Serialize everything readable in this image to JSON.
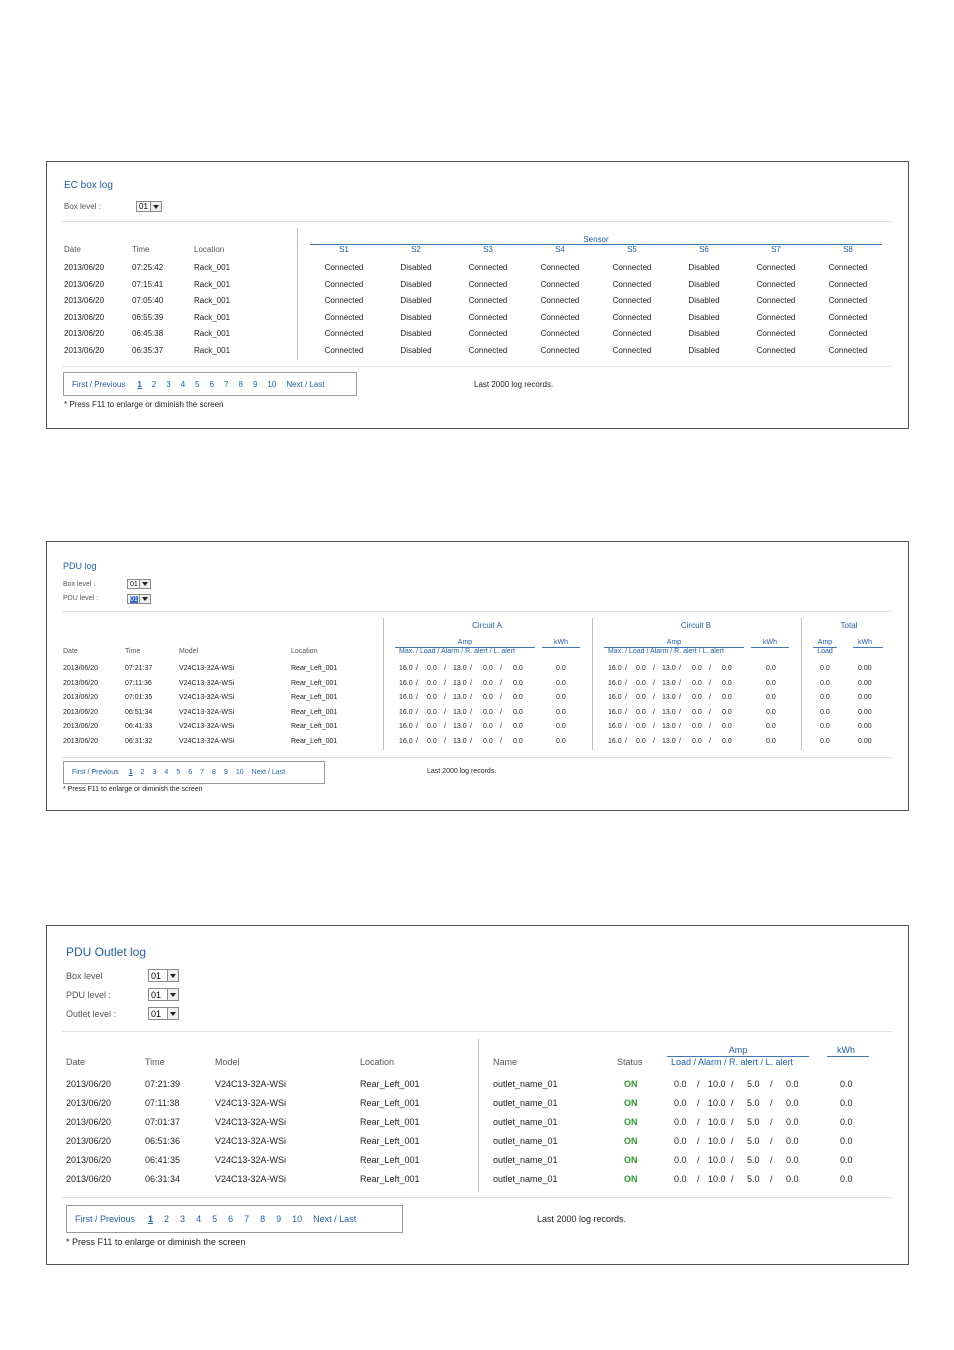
{
  "ec": {
    "title": "EC  box  log",
    "box_level_label": "Box level :",
    "box_level_value": "01",
    "headers": {
      "date": "Date",
      "time": "Time",
      "location": "Location"
    },
    "sensor_group": "Sensor",
    "sensors": [
      "S1",
      "S2",
      "S3",
      "S4",
      "S5",
      "S6",
      "S7",
      "S8"
    ],
    "rows": [
      {
        "date": "2013/06/20",
        "time": "07:25:42",
        "location": "Rack_001",
        "s": [
          "Connected",
          "Disabled",
          "Connected",
          "Connected",
          "Connected",
          "Disabled",
          "Connected",
          "Connected"
        ]
      },
      {
        "date": "2013/06/20",
        "time": "07:15:41",
        "location": "Rack_001",
        "s": [
          "Connected",
          "Disabled",
          "Connected",
          "Connected",
          "Connected",
          "Disabled",
          "Connected",
          "Connected"
        ]
      },
      {
        "date": "2013/06/20",
        "time": "07:05:40",
        "location": "Rack_001",
        "s": [
          "Connected",
          "Disabled",
          "Connected",
          "Connected",
          "Connected",
          "Disabled",
          "Connected",
          "Connected"
        ]
      },
      {
        "date": "2013/06/20",
        "time": "06:55:39",
        "location": "Rack_001",
        "s": [
          "Connected",
          "Disabled",
          "Connected",
          "Connected",
          "Connected",
          "Disabled",
          "Connected",
          "Connected"
        ]
      },
      {
        "date": "2013/06/20",
        "time": "06:45:38",
        "location": "Rack_001",
        "s": [
          "Connected",
          "Disabled",
          "Connected",
          "Connected",
          "Connected",
          "Disabled",
          "Connected",
          "Connected"
        ]
      },
      {
        "date": "2013/06/20",
        "time": "06:35:37",
        "location": "Rack_001",
        "s": [
          "Connected",
          "Disabled",
          "Connected",
          "Connected",
          "Connected",
          "Disabled",
          "Connected",
          "Connected"
        ]
      }
    ],
    "pager": {
      "first_prev": "First / Previous",
      "pages": [
        "1",
        "2",
        "3",
        "4",
        "5",
        "6",
        "7",
        "8",
        "9",
        "10"
      ],
      "current": "1",
      "next_last": "Next / Last"
    },
    "records": "Last 2000 log records.",
    "note": "* Press F11 to enlarge or diminish the screen"
  },
  "pdu": {
    "title": "PDU  log",
    "box_level_label": "Box level :",
    "box_level_value": "01",
    "pdu_level_label": "PDU level :",
    "pdu_level_value": "01",
    "headers": {
      "date": "Date",
      "time": "Time",
      "model": "Model",
      "location": "Location"
    },
    "circuit_a": "Circuit   A",
    "circuit_b": "Circuit   B",
    "total": "Total",
    "amp": "Amp",
    "kwh": "kWh",
    "amp_sub": "Max.  /  Load  / Alarm / R. alert / L. alert",
    "total_amp": "Amp",
    "total_load": "Load",
    "total_kwh": "kWh",
    "rows": [
      {
        "date": "2013/06/20",
        "time": "07:21:37",
        "model": "V24C13-32A-WSi",
        "location": "Rear_Left_001",
        "a": [
          "16.0",
          "0.0",
          "13.0",
          "0.0",
          "0.0"
        ],
        "akwh": "0.0",
        "b": [
          "16.0",
          "0.0",
          "13.0",
          "0.0",
          "0.0"
        ],
        "bkwh": "0.0",
        "tload": "0.0",
        "tkwh": "0.00"
      },
      {
        "date": "2013/06/20",
        "time": "07:11:36",
        "model": "V24C13-32A-WSi",
        "location": "Rear_Left_001",
        "a": [
          "16.0",
          "0.0",
          "13.0",
          "0.0",
          "0.0"
        ],
        "akwh": "0.0",
        "b": [
          "16.0",
          "0.0",
          "13.0",
          "0.0",
          "0.0"
        ],
        "bkwh": "0.0",
        "tload": "0.0",
        "tkwh": "0.00"
      },
      {
        "date": "2013/06/20",
        "time": "07:01:35",
        "model": "V24C13-32A-WSi",
        "location": "Rear_Left_001",
        "a": [
          "16.0",
          "0.0",
          "13.0",
          "0.0",
          "0.0"
        ],
        "akwh": "0.0",
        "b": [
          "16.0",
          "0.0",
          "13.0",
          "0.0",
          "0.0"
        ],
        "bkwh": "0.0",
        "tload": "0.0",
        "tkwh": "0.00"
      },
      {
        "date": "2013/06/20",
        "time": "06:51:34",
        "model": "V24C13-32A-WSi",
        "location": "Rear_Left_001",
        "a": [
          "16.0",
          "0.0",
          "13.0",
          "0.0",
          "0.0"
        ],
        "akwh": "0.0",
        "b": [
          "16.0",
          "0.0",
          "13.0",
          "0.0",
          "0.0"
        ],
        "bkwh": "0.0",
        "tload": "0.0",
        "tkwh": "0.00"
      },
      {
        "date": "2013/06/20",
        "time": "06:41:33",
        "model": "V24C13-32A-WSi",
        "location": "Rear_Left_001",
        "a": [
          "16.0",
          "0.0",
          "13.0",
          "0.0",
          "0.0"
        ],
        "akwh": "0.0",
        "b": [
          "16.0",
          "0.0",
          "13.0",
          "0.0",
          "0.0"
        ],
        "bkwh": "0.0",
        "tload": "0.0",
        "tkwh": "0.00"
      },
      {
        "date": "2013/06/20",
        "time": "06:31:32",
        "model": "V24C13-32A-WSi",
        "location": "Rear_Left_001",
        "a": [
          "16.0",
          "0.0",
          "13.0",
          "0.0",
          "0.0"
        ],
        "akwh": "0.0",
        "b": [
          "16.0",
          "0.0",
          "13.0",
          "0.0",
          "0.0"
        ],
        "bkwh": "0.0",
        "tload": "0.0",
        "tkwh": "0.00"
      }
    ],
    "pager": {
      "first_prev": "First / Previous",
      "pages": [
        "1",
        "2",
        "3",
        "4",
        "5",
        "6",
        "7",
        "8",
        "9",
        "10"
      ],
      "current": "1",
      "next_last": "Next / Last"
    },
    "records": "Last 2000 log records.",
    "note": "* Press F11 to enlarge or diminish the screen"
  },
  "outlet": {
    "title": "PDU  Outlet  log",
    "box_level_label": "Box level",
    "box_level_value": "01",
    "pdu_level_label": "PDU level :",
    "pdu_level_value": "01",
    "outlet_level_label": "Outlet level :",
    "outlet_level_value": "01",
    "headers": {
      "date": "Date",
      "time": "Time",
      "model": "Model",
      "location": "Location",
      "name": "Name",
      "status": "Status"
    },
    "amp": "Amp",
    "amp_sub": "Load  / Alarm / R. alert / L. alert",
    "kwh": "kWh",
    "rows": [
      {
        "date": "2013/06/20",
        "time": "07:21:39",
        "model": "V24C13-32A-WSi",
        "location": "Rear_Left_001",
        "name": "outlet_name_01",
        "status": "ON",
        "amp": [
          "0.0",
          "10.0",
          "5.0",
          "0.0"
        ],
        "kwh": "0.0"
      },
      {
        "date": "2013/06/20",
        "time": "07:11:38",
        "model": "V24C13-32A-WSi",
        "location": "Rear_Left_001",
        "name": "outlet_name_01",
        "status": "ON",
        "amp": [
          "0.0",
          "10.0",
          "5.0",
          "0.0"
        ],
        "kwh": "0.0"
      },
      {
        "date": "2013/06/20",
        "time": "07:01:37",
        "model": "V24C13-32A-WSi",
        "location": "Rear_Left_001",
        "name": "outlet_name_01",
        "status": "ON",
        "amp": [
          "0.0",
          "10.0",
          "5.0",
          "0.0"
        ],
        "kwh": "0.0"
      },
      {
        "date": "2013/06/20",
        "time": "06:51:36",
        "model": "V24C13-32A-WSi",
        "location": "Rear_Left_001",
        "name": "outlet_name_01",
        "status": "ON",
        "amp": [
          "0.0",
          "10.0",
          "5.0",
          "0.0"
        ],
        "kwh": "0.0"
      },
      {
        "date": "2013/06/20",
        "time": "06:41:35",
        "model": "V24C13-32A-WSi",
        "location": "Rear_Left_001",
        "name": "outlet_name_01",
        "status": "ON",
        "amp": [
          "0.0",
          "10.0",
          "5.0",
          "0.0"
        ],
        "kwh": "0.0"
      },
      {
        "date": "2013/06/20",
        "time": "06:31:34",
        "model": "V24C13-32A-WSi",
        "location": "Rear_Left_001",
        "name": "outlet_name_01",
        "status": "ON",
        "amp": [
          "0.0",
          "10.0",
          "5.0",
          "0.0"
        ],
        "kwh": "0.0"
      }
    ],
    "pager": {
      "first_prev": "First / Previous",
      "pages": [
        "1",
        "2",
        "3",
        "4",
        "5",
        "6",
        "7",
        "8",
        "9",
        "10"
      ],
      "current": "1",
      "next_last": "Next / Last"
    },
    "records": "Last 2000 log records.",
    "note": "* Press F11 to enlarge or diminish the screen"
  }
}
